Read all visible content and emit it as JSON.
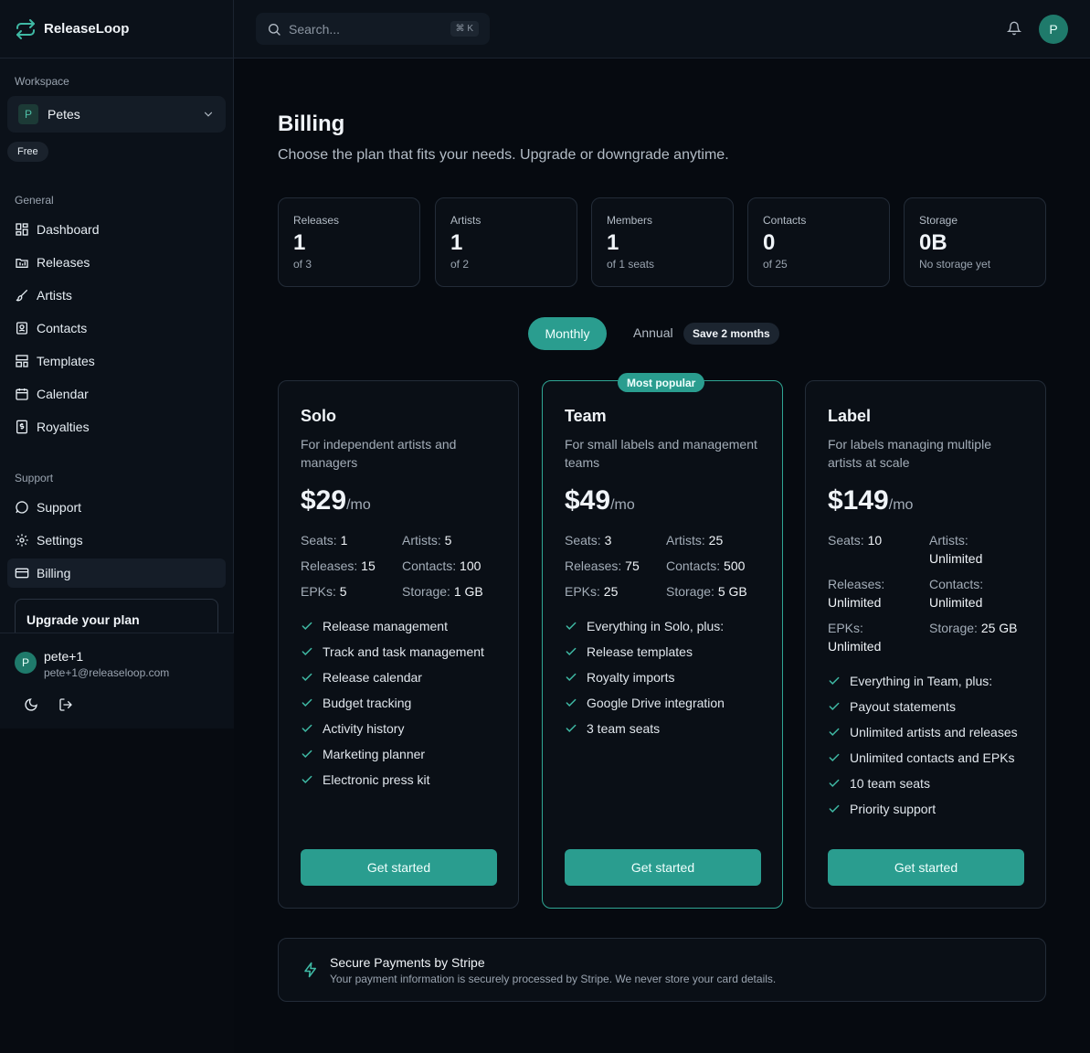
{
  "app": {
    "name": "ReleaseLoop"
  },
  "sidebar": {
    "workspace_label": "Workspace",
    "workspace": {
      "initial": "P",
      "name": "Petes"
    },
    "plan_badge": "Free",
    "general_label": "General",
    "general_items": [
      {
        "label": "Dashboard",
        "icon": "dashboard-icon"
      },
      {
        "label": "Releases",
        "icon": "releases-icon"
      },
      {
        "label": "Artists",
        "icon": "artists-icon"
      },
      {
        "label": "Contacts",
        "icon": "contacts-icon"
      },
      {
        "label": "Templates",
        "icon": "templates-icon"
      },
      {
        "label": "Calendar",
        "icon": "calendar-icon"
      },
      {
        "label": "Royalties",
        "icon": "royalties-icon"
      }
    ],
    "support_label": "Support",
    "support_items": [
      {
        "label": "Support",
        "icon": "support-icon"
      },
      {
        "label": "Settings",
        "icon": "settings-icon"
      },
      {
        "label": "Billing",
        "icon": "billing-icon",
        "active": true
      }
    ],
    "upgrade_title": "Upgrade your plan",
    "user": {
      "initial": "P",
      "name": "pete+1",
      "email": "pete+1@releaseloop.com"
    }
  },
  "topbar": {
    "search_placeholder": "Search...",
    "shortcut": "⌘ K",
    "avatar_initial": "P"
  },
  "billing": {
    "title": "Billing",
    "subtitle": "Choose the plan that fits your needs. Upgrade or downgrade anytime.",
    "usage": [
      {
        "label": "Releases",
        "value": "1",
        "of": "of 3"
      },
      {
        "label": "Artists",
        "value": "1",
        "of": "of 2"
      },
      {
        "label": "Members",
        "value": "1",
        "of": "of 1 seats"
      },
      {
        "label": "Contacts",
        "value": "0",
        "of": "of 25"
      },
      {
        "label": "Storage",
        "value": "0B",
        "of": "No storage yet"
      }
    ],
    "toggle": {
      "monthly": "Monthly",
      "annual": "Annual",
      "save_badge": "Save 2 months",
      "selected": "Monthly"
    },
    "popular_badge": "Most popular",
    "plans": [
      {
        "name": "Solo",
        "desc": "For independent artists and managers",
        "price": "$29",
        "per": "/mo",
        "limits": [
          {
            "k": "Seats:",
            "v": "1"
          },
          {
            "k": "Artists:",
            "v": "5"
          },
          {
            "k": "Releases:",
            "v": "15"
          },
          {
            "k": "Contacts:",
            "v": "100"
          },
          {
            "k": "EPKs:",
            "v": "5"
          },
          {
            "k": "Storage:",
            "v": "1 GB"
          }
        ],
        "features": [
          "Release management",
          "Track and task management",
          "Release calendar",
          "Budget tracking",
          "Activity history",
          "Marketing planner",
          "Electronic press kit"
        ],
        "cta": "Get started"
      },
      {
        "name": "Team",
        "desc": "For small labels and management teams",
        "price": "$49",
        "per": "/mo",
        "limits": [
          {
            "k": "Seats:",
            "v": "3"
          },
          {
            "k": "Artists:",
            "v": "25"
          },
          {
            "k": "Releases:",
            "v": "75"
          },
          {
            "k": "Contacts:",
            "v": "500"
          },
          {
            "k": "EPKs:",
            "v": "25"
          },
          {
            "k": "Storage:",
            "v": "5 GB"
          }
        ],
        "features": [
          "Everything in Solo, plus:",
          "Release templates",
          "Royalty imports",
          "Google Drive integration",
          "3 team seats"
        ],
        "cta": "Get started"
      },
      {
        "name": "Label",
        "desc": "For labels managing multiple artists at scale",
        "price": "$149",
        "per": "/mo",
        "limits": [
          {
            "k": "Seats:",
            "v": "10"
          },
          {
            "k": "Artists:",
            "v": "Unlimited"
          },
          {
            "k": "Releases:",
            "v": "Unlimited"
          },
          {
            "k": "Contacts:",
            "v": "Unlimited"
          },
          {
            "k": "EPKs:",
            "v": "Unlimited"
          },
          {
            "k": "Storage:",
            "v": "25 GB"
          }
        ],
        "features": [
          "Everything in Team, plus:",
          "Payout statements",
          "Unlimited artists and releases",
          "Unlimited contacts and EPKs",
          "10 team seats",
          "Priority support"
        ],
        "cta": "Get started"
      }
    ],
    "stripe": {
      "title": "Secure Payments by Stripe",
      "text": "Your payment information is securely processed by Stripe. We never store your card details."
    }
  },
  "colors": {
    "accent": "#2a9d8f",
    "background": "#060a10",
    "panel": "#0b1119"
  }
}
